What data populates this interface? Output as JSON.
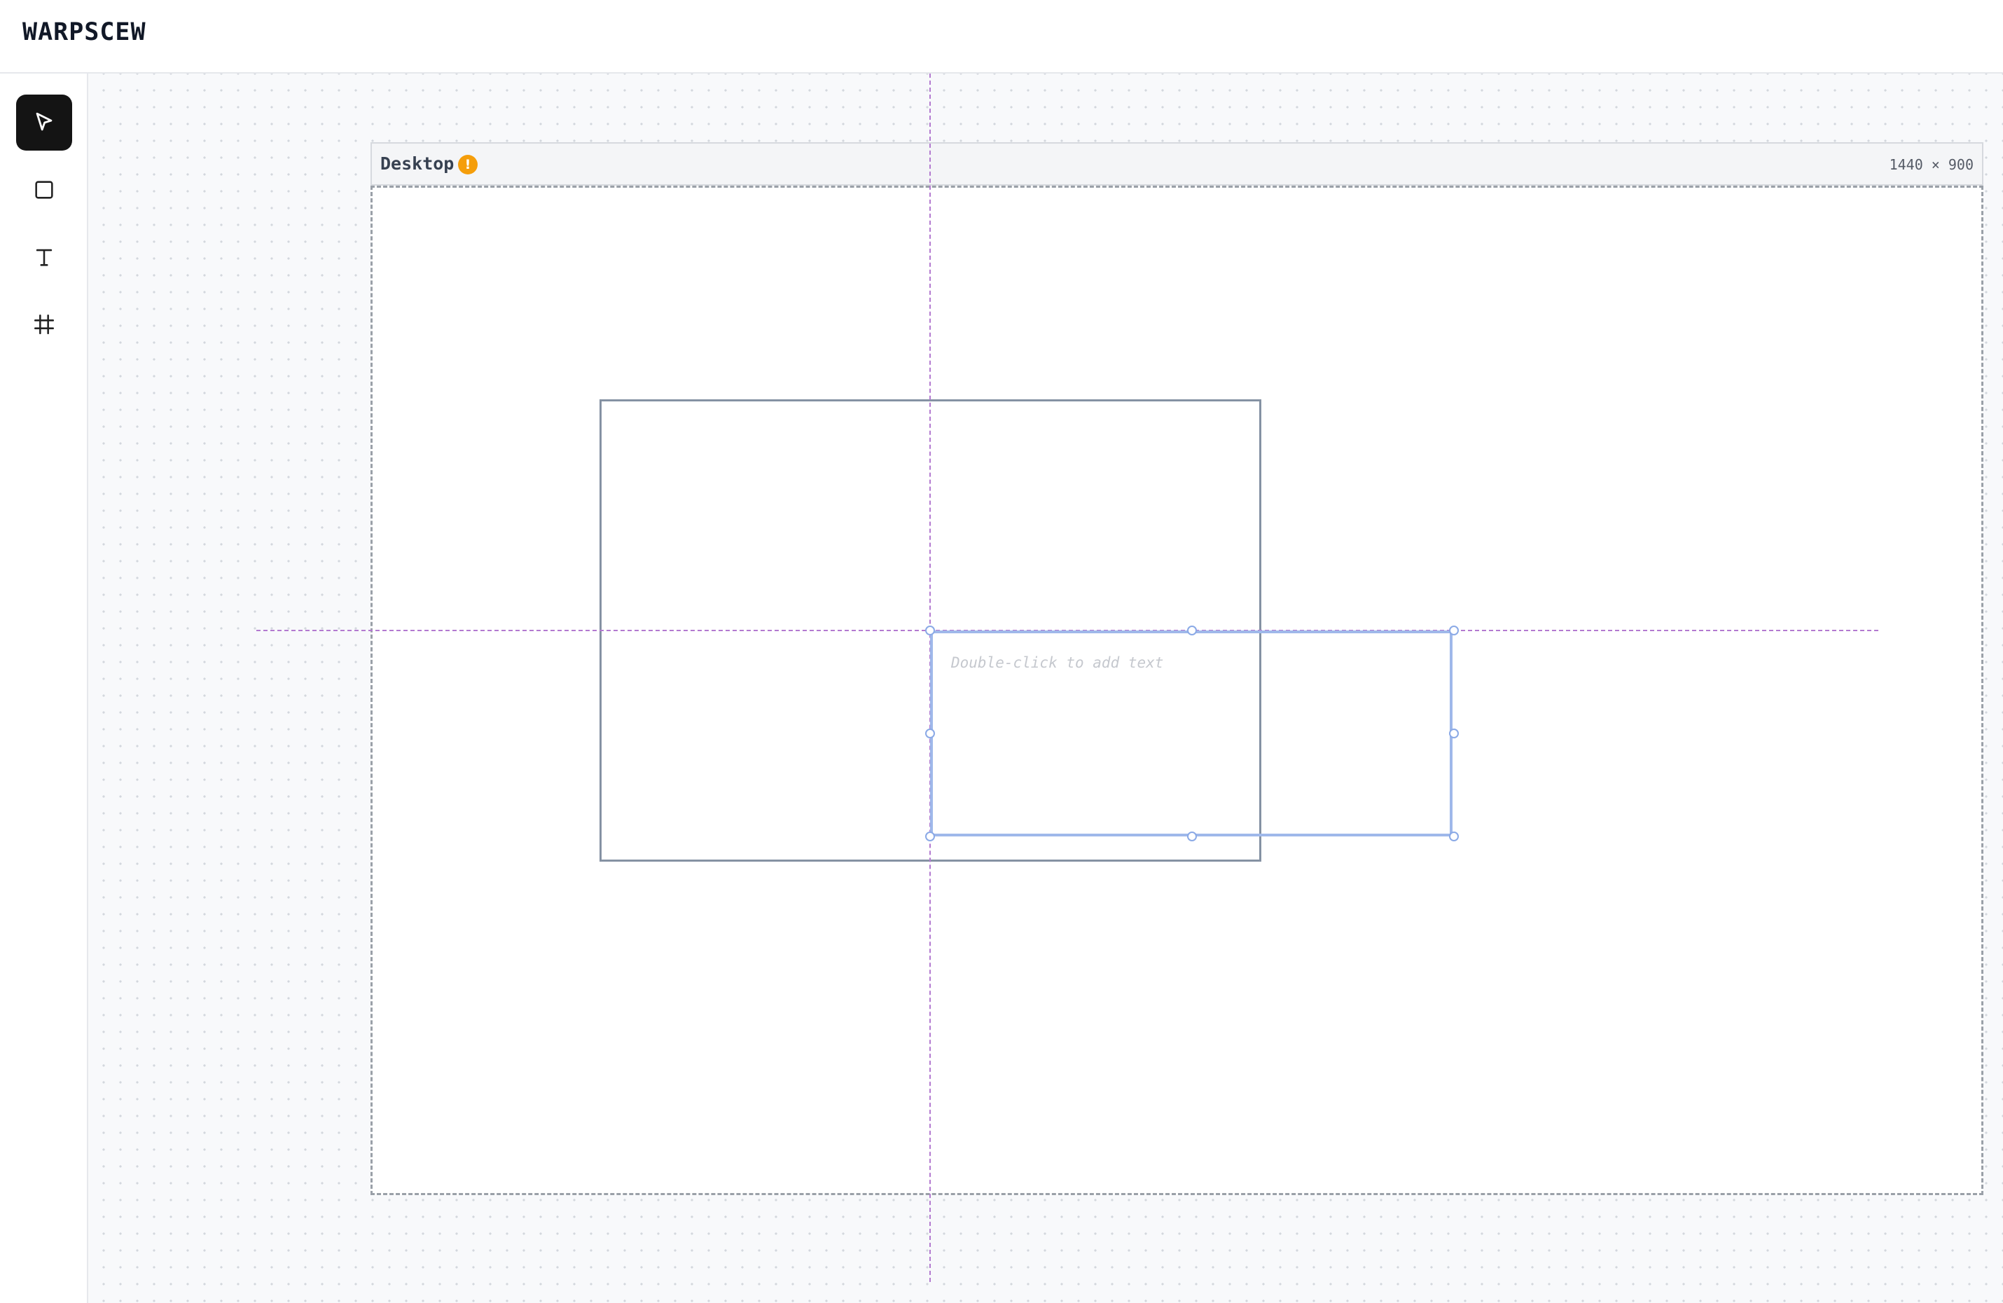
{
  "app": {
    "title": "WARPSCEW"
  },
  "toolbar": {
    "tools": [
      {
        "name": "select",
        "icon": "pointer-icon",
        "active": true
      },
      {
        "name": "rectangle",
        "icon": "square-icon",
        "active": false
      },
      {
        "name": "text",
        "icon": "text-icon",
        "active": false
      },
      {
        "name": "frame",
        "icon": "frame-icon",
        "active": false
      }
    ]
  },
  "canvas": {
    "frame": {
      "name": "Desktop",
      "warning_icon": "warning-icon",
      "warning_glyph": "!",
      "size_label": "1440 × 900"
    },
    "text_element": {
      "placeholder": "Double-click to add text"
    },
    "colors": {
      "guide": "#b37ad0",
      "selection": "#9fb8ea",
      "warning": "#f59e0b",
      "active_tool": "#141414"
    }
  }
}
